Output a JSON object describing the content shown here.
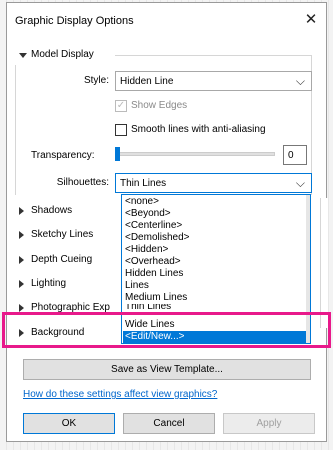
{
  "window": {
    "title": "Graphic Display Options",
    "close_glyph": "✕"
  },
  "model_display": {
    "header": "Model Display",
    "style_label": "Style:",
    "style_value": "Hidden Line",
    "show_edges_label": "Show Edges",
    "show_edges_checked": true,
    "smooth_lines_label": "Smooth lines with anti-aliasing",
    "smooth_lines_checked": false,
    "transparency_label": "Transparency:",
    "transparency_value": "0",
    "silhouettes_label": "Silhouettes:",
    "silhouettes_value": "Thin Lines"
  },
  "sections": [
    {
      "label": "Shadows"
    },
    {
      "label": "Sketchy Lines"
    },
    {
      "label": "Depth Cueing"
    },
    {
      "label": "Lighting"
    },
    {
      "label": "Photographic Exp"
    },
    {
      "label": "Background"
    }
  ],
  "silhouette_options": [
    {
      "label": "<none>"
    },
    {
      "label": "<Beyond>"
    },
    {
      "label": "<Centerline>"
    },
    {
      "label": "<Demolished>"
    },
    {
      "label": "<Hidden>"
    },
    {
      "label": "<Overhead>"
    },
    {
      "label": "Hidden Lines"
    },
    {
      "label": "Lines"
    },
    {
      "label": "Medium Lines"
    },
    {
      "label": "Thin Lines"
    },
    {
      "label": "Wide Lines"
    },
    {
      "label": "<Edit/New...>"
    }
  ],
  "selected_option": "<Edit/New...>",
  "buttons": {
    "save_template": "Save as View Template...",
    "ok": "OK",
    "cancel": "Cancel",
    "apply": "Apply"
  },
  "help_link": "How do these settings affect view graphics?",
  "colors": {
    "accent": "#0078d7",
    "highlight": "#e8198b",
    "link": "#0066cc"
  },
  "icons": {
    "close": "close-icon",
    "expand": "chevron-right-icon",
    "collapse": "chevron-down-icon",
    "dropdown": "chevron-down-icon"
  }
}
